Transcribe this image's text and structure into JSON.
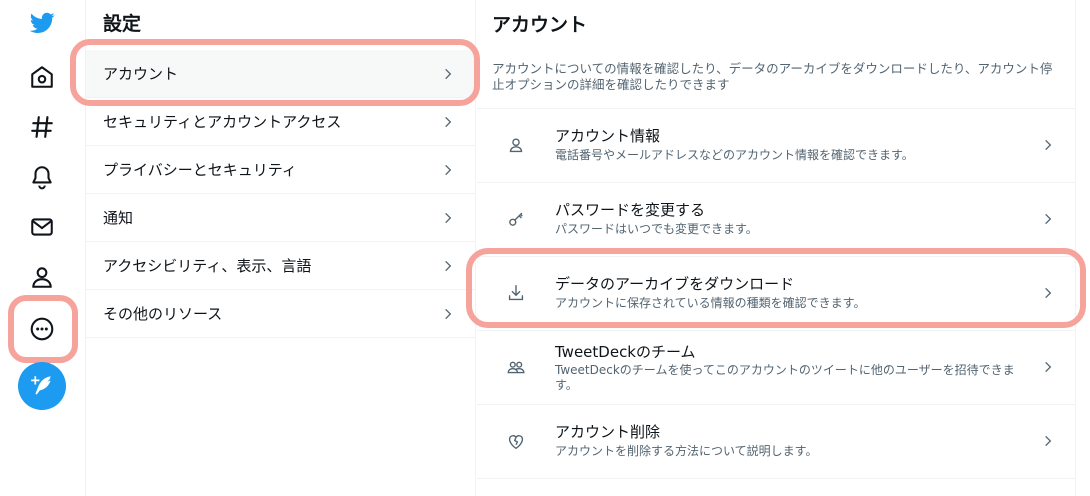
{
  "rail": {
    "items": [
      {
        "name": "twitter-logo"
      },
      {
        "name": "home-icon"
      },
      {
        "name": "explore-hashtag-icon"
      },
      {
        "name": "notifications-bell-icon"
      },
      {
        "name": "messages-envelope-icon"
      },
      {
        "name": "profile-person-icon"
      },
      {
        "name": "more-dots-icon"
      },
      {
        "name": "compose-tweet-icon"
      }
    ],
    "accent_color": "#1d9bf0",
    "highlight_color": "#f6a39b"
  },
  "settings": {
    "title": "設定",
    "items": [
      {
        "label": "アカウント",
        "active": true
      },
      {
        "label": "セキュリティとアカウントアクセス"
      },
      {
        "label": "プライバシーとセキュリティ"
      },
      {
        "label": "通知"
      },
      {
        "label": "アクセシビリティ、表示、言語"
      },
      {
        "label": "その他のリソース"
      }
    ]
  },
  "account": {
    "title": "アカウント",
    "description": "アカウントについての情報を確認したり、データのアーカイブをダウンロードしたり、アカウント停止オプションの詳細を確認したりできます",
    "rows": [
      {
        "title": "アカウント情報",
        "subtitle": "電話番号やメールアドレスなどのアカウント情報を確認できます。",
        "icon": "person-outline-icon"
      },
      {
        "title": "パスワードを変更する",
        "subtitle": "パスワードはいつでも変更できます。",
        "icon": "key-icon"
      },
      {
        "title": "データのアーカイブをダウンロード",
        "subtitle": "アカウントに保存されている情報の種類を確認できます。",
        "icon": "download-icon"
      },
      {
        "title": "TweetDeckのチーム",
        "subtitle": "TweetDeckのチームを使ってこのアカウントのツイートに他のユーザーを招待できます。",
        "icon": "people-icon"
      },
      {
        "title": "アカウント削除",
        "subtitle": "アカウントを削除する方法について説明します。",
        "icon": "broken-heart-icon"
      }
    ]
  }
}
